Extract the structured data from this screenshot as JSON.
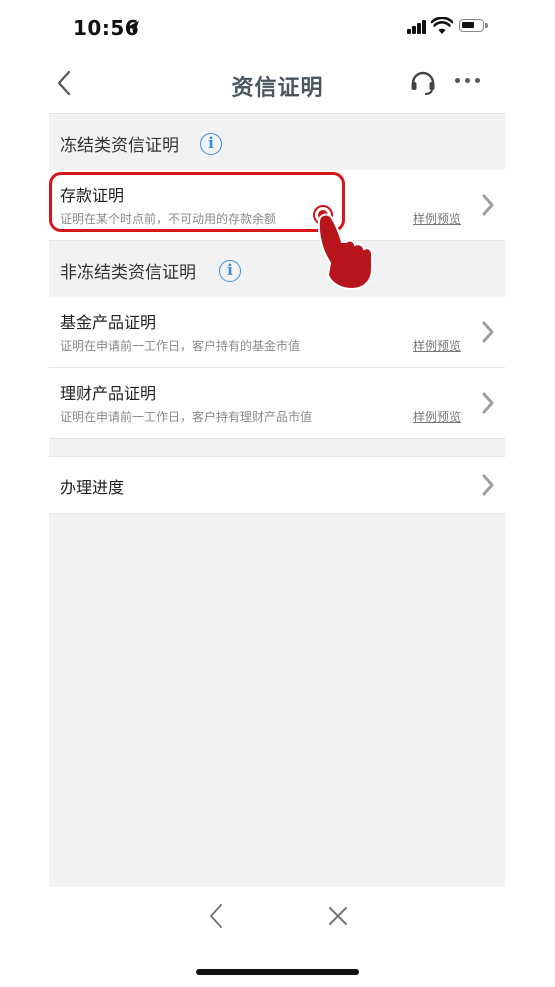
{
  "status_bar": {
    "time": "10:56"
  },
  "nav": {
    "title": "资信证明"
  },
  "sections": {
    "frozen": {
      "title": "冻结类资信证明",
      "info_glyph": "i",
      "items": [
        {
          "title": "存款证明",
          "subtitle": "证明在某个时点前，不可动用的存款余额",
          "link": "样例预览"
        }
      ]
    },
    "non_frozen": {
      "title": "非冻结类资信证明",
      "info_glyph": "i",
      "items": [
        {
          "title": "基金产品证明",
          "subtitle": "证明在申请前一工作日，客户持有的基金市值",
          "link": "样例预览"
        },
        {
          "title": "理财产品证明",
          "subtitle": "证明在申请前一工作日，客户持有理财产品市值",
          "link": "样例预览"
        }
      ]
    }
  },
  "progress_row": {
    "title": "办理进度"
  },
  "colors": {
    "highlight": "#d7161b",
    "info_blue": "#3b8fd6",
    "panel_bg": "#f2f2f3",
    "title_gray": "#4a5560"
  },
  "icons": [
    "location-arrow-icon",
    "signal-icon",
    "wifi-icon",
    "battery-icon",
    "back-chevron-icon",
    "headset-icon",
    "more-icon",
    "info-icon",
    "chevron-right-icon",
    "tap-hand-icon",
    "close-icon"
  ]
}
